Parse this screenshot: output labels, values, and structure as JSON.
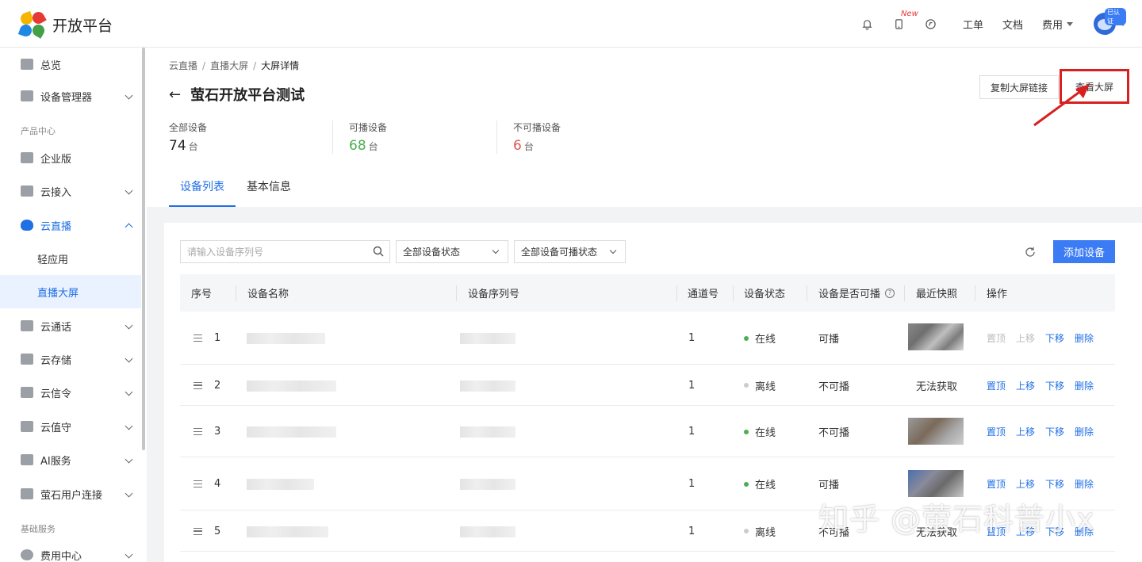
{
  "header": {
    "brand": "开放平台",
    "new_badge": "New",
    "links": [
      "工单",
      "文档",
      "费用"
    ],
    "verified": "已认证",
    "icons": [
      "bell-icon",
      "phone-icon",
      "help-icon"
    ]
  },
  "sidebar": {
    "items": [
      {
        "label": "总览"
      },
      {
        "label": "设备管理器"
      },
      {
        "label": "企业版"
      },
      {
        "label": "云接入"
      },
      {
        "label": "云直播"
      },
      {
        "label": "云通话"
      },
      {
        "label": "云存储"
      },
      {
        "label": "云信令"
      },
      {
        "label": "云值守"
      },
      {
        "label": "AI服务"
      },
      {
        "label": "萤石用户连接"
      },
      {
        "label": "费用中心"
      }
    ],
    "sub_items": [
      "轻应用",
      "直播大屏"
    ],
    "groups": [
      "产品中心",
      "基础服务"
    ]
  },
  "breadcrumb": [
    "云直播",
    "直播大屏",
    "大屏详情"
  ],
  "page_title": "萤石开放平台测试",
  "stats": [
    {
      "label": "全部设备",
      "value": "74",
      "unit": "台"
    },
    {
      "label": "可播设备",
      "value": "68",
      "unit": "台"
    },
    {
      "label": "不可播设备",
      "value": "6",
      "unit": "台"
    }
  ],
  "tabs": [
    "设备列表",
    "基本信息"
  ],
  "actions": {
    "copy": "复制大屏链接",
    "view": "查看大屏"
  },
  "toolbar": {
    "search_placeholder": "请输入设备序列号",
    "status_select": "全部设备状态",
    "play_select": "全部设备可播状态",
    "add": "添加设备"
  },
  "table": {
    "headers": [
      "序号",
      "设备名称",
      "设备序列号",
      "通道号",
      "设备状态",
      "设备是否可播",
      "最近快照",
      "操作"
    ],
    "ops": [
      "置顶",
      "上移",
      "下移",
      "删除"
    ],
    "rows": [
      {
        "no": "1",
        "channel": "1",
        "status": "在线",
        "online": true,
        "playable": "可播",
        "snapshot": ""
      },
      {
        "no": "2",
        "channel": "1",
        "status": "离线",
        "online": false,
        "playable": "不可播",
        "snapshot": "无法获取"
      },
      {
        "no": "3",
        "channel": "1",
        "status": "在线",
        "online": true,
        "playable": "不可播",
        "snapshot": ""
      },
      {
        "no": "4",
        "channel": "1",
        "status": "在线",
        "online": true,
        "playable": "可播",
        "snapshot": ""
      },
      {
        "no": "5",
        "channel": "1",
        "status": "离线",
        "online": false,
        "playable": "不可播",
        "snapshot": "无法获取"
      }
    ]
  },
  "watermark": "知乎 @萤石科普小x",
  "colors": {
    "primary": "#1f6fe5",
    "online": "#4caf50",
    "offline": "#cccccc",
    "alert": "#d82020"
  }
}
